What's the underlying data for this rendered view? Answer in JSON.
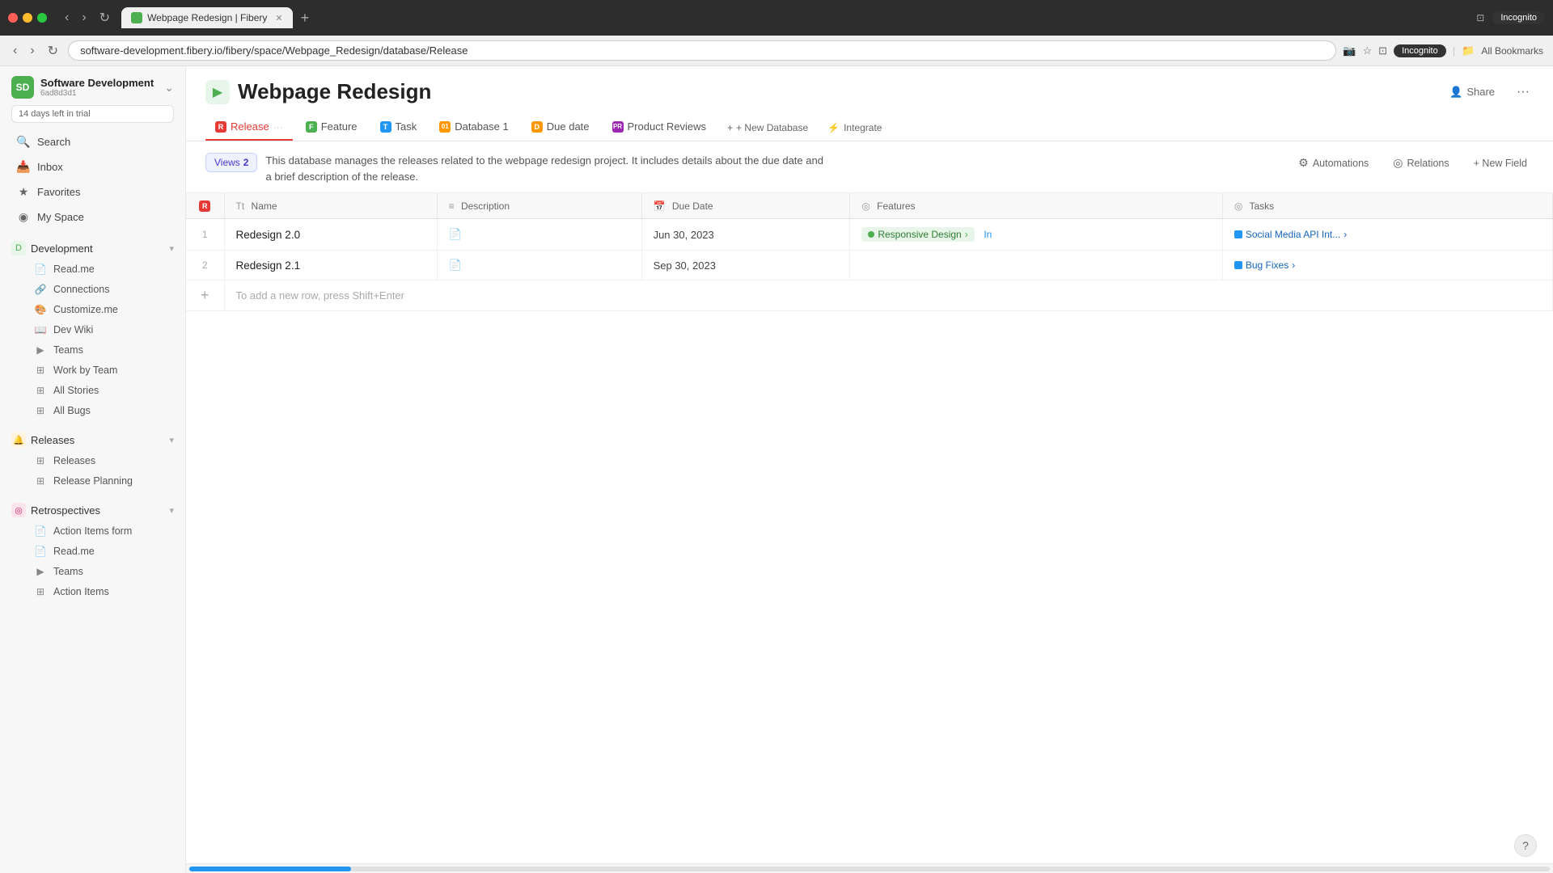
{
  "browser": {
    "tab_title": "Webpage Redesign | Fibery",
    "tab_favicon": "F",
    "address": "software-development.fibery.io/fibery/space/Webpage_Redesign/database/Release",
    "incognito_label": "Incognito",
    "bookmarks_label": "All Bookmarks"
  },
  "workspace": {
    "name": "Software Development",
    "id": "6ad8d3d1",
    "icon": "SD",
    "trial_text": "14 days left in trial"
  },
  "sidebar": {
    "search_label": "Search",
    "inbox_label": "Inbox",
    "favorites_label": "Favorites",
    "myspace_label": "My Space",
    "sections": [
      {
        "name": "Development",
        "items": [
          "Read.me",
          "Connections",
          "Customize.me",
          "Dev Wiki",
          "Teams",
          "Work by Team",
          "All Stories",
          "All Bugs"
        ]
      },
      {
        "name": "Releases",
        "items": [
          "Releases",
          "Release Planning"
        ]
      },
      {
        "name": "Retrospectives",
        "items": [
          "Action Items form",
          "Read.me",
          "Teams",
          "Action Items"
        ]
      }
    ]
  },
  "page": {
    "title": "Webpage Redesign",
    "icon": "▶",
    "share_label": "Share",
    "description": "This database manages the releases related to the webpage redesign project. It includes details about the due date and a brief description of the release.",
    "views_label": "Views",
    "views_count": "2"
  },
  "tabs": [
    {
      "label": "Release",
      "type": "red",
      "active": true,
      "icon": "R"
    },
    {
      "label": "Feature",
      "type": "green",
      "active": false,
      "icon": "F"
    },
    {
      "label": "Task",
      "type": "blue",
      "active": false,
      "icon": "T"
    },
    {
      "label": "Database 1",
      "type": "orange",
      "active": false,
      "icon": "01"
    },
    {
      "label": "Due date",
      "type": "orange",
      "active": false,
      "icon": "D"
    },
    {
      "label": "Product Reviews",
      "type": "purple",
      "active": false,
      "icon": "PR"
    }
  ],
  "toolbar": {
    "new_database_label": "+ New Database",
    "integrate_label": "Integrate",
    "automations_label": "Automations",
    "relations_label": "Relations",
    "new_field_label": "+ New Field"
  },
  "table": {
    "columns": [
      {
        "id": "num",
        "label": "#",
        "icon": ""
      },
      {
        "id": "name",
        "label": "Name",
        "icon": "Tt"
      },
      {
        "id": "description",
        "label": "Description",
        "icon": "≡"
      },
      {
        "id": "due_date",
        "label": "Due Date",
        "icon": "📅"
      },
      {
        "id": "features",
        "label": "Features",
        "icon": "◎"
      },
      {
        "id": "tasks",
        "label": "Tasks",
        "icon": "◎"
      }
    ],
    "rows": [
      {
        "num": "1",
        "name": "Redesign 2.0",
        "has_description_icon": true,
        "due_date": "Jun 30, 2023",
        "features": [
          {
            "label": "Responsive Design",
            "has_arrow": true
          },
          {
            "label": "In",
            "has_arrow": false
          }
        ],
        "tasks": [
          {
            "label": "Social Media API Int...",
            "has_arrow": true
          }
        ]
      },
      {
        "num": "2",
        "name": "Redesign 2.1",
        "has_description_icon": true,
        "due_date": "Sep 30, 2023",
        "features": [],
        "tasks": [
          {
            "label": "Bug Fixes",
            "has_arrow": true
          }
        ]
      }
    ],
    "add_row_hint": "To add a new row, press Shift+Enter"
  }
}
